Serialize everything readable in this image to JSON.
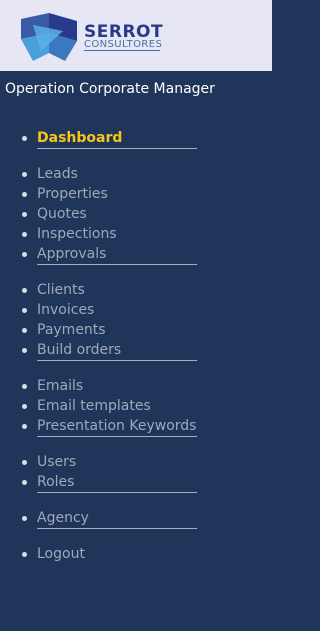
{
  "brand": {
    "name": "SERROT",
    "subtitle": "CONSULTORES",
    "colors": {
      "dark_blue": "#2a3a8a",
      "mid_blue": "#3a5aa8",
      "light_blue": "#4a9fd8"
    }
  },
  "app_title": "Operation Corporate Manager",
  "nav": {
    "dashboard": "Dashboard",
    "leads": "Leads",
    "properties": "Properties",
    "quotes": "Quotes",
    "inspections": "Inspections",
    "approvals": "Approvals",
    "clients": "Clients",
    "invoices": "Invoices",
    "payments": "Payments",
    "build_orders": "Build orders",
    "emails": "Emails",
    "email_templates": "Email templates",
    "presentation_keywords": "Presentation Keywords",
    "users": "Users",
    "roles": "Roles",
    "agency": "Agency",
    "logout": "Logout"
  },
  "colors": {
    "sidebar_bg": "#1f3559",
    "header_bg": "#e6e6f4",
    "active": "#f5c518",
    "inactive": "#9fa9ba"
  }
}
